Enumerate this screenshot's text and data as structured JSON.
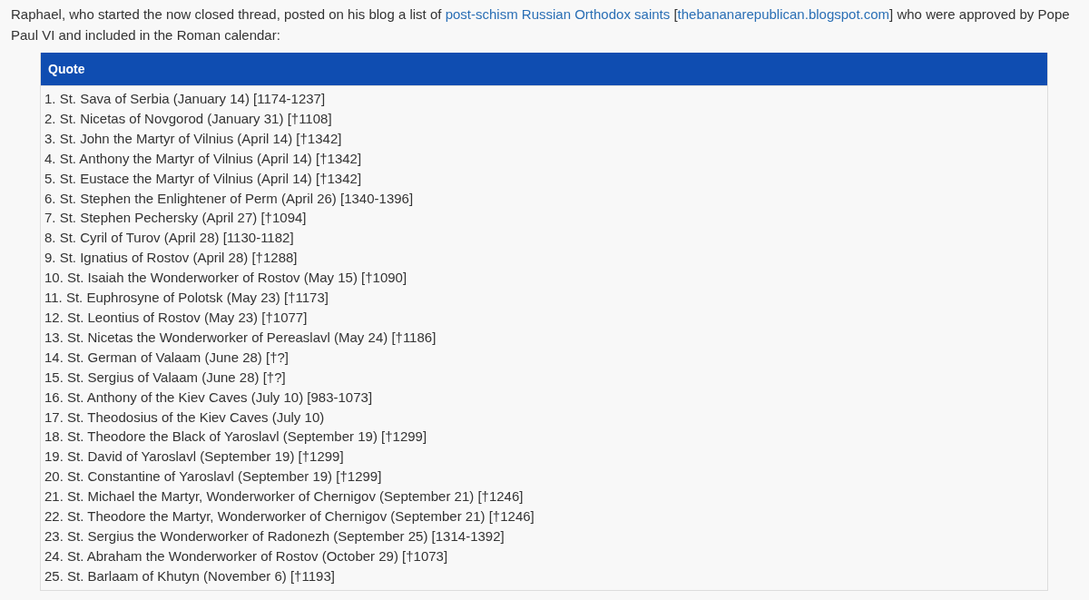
{
  "intro": [
    {
      "kind": "text",
      "text": "Raphael, who started the now closed thread, posted on his blog a list of "
    },
    {
      "kind": "link",
      "text": "post-schism Russian Orthodox saints"
    },
    {
      "kind": "text",
      "text": " ["
    },
    {
      "kind": "link",
      "text": "thebananarepublican.blogspot.com"
    },
    {
      "kind": "text",
      "text": "] who were approved by Pope Paul VI and included in the Roman calendar:"
    }
  ],
  "quote": {
    "title": "Quote",
    "lines": [
      "1. St. Sava of Serbia (January 14) [1174-1237]",
      "2. St. Nicetas of Novgorod (January 31) [†1108]",
      "3. St. John the Martyr of Vilnius (April 14) [†1342]",
      "4. St. Anthony the Martyr of Vilnius (April 14) [†1342]",
      "5. St. Eustace the Martyr of Vilnius (April 14) [†1342]",
      "6. St. Stephen the Enlightener of Perm (April 26) [1340-1396]",
      "7. St. Stephen Pechersky (April 27) [†1094]",
      "8. St. Cyril of Turov (April 28) [1130-1182]",
      "9. St. Ignatius of Rostov (April 28) [†1288]",
      "10. St. Isaiah the Wonderworker of Rostov (May 15) [†1090]",
      "11. St. Euphrosyne of Polotsk (May 23) [†1173]",
      "12. St. Leontius of Rostov (May 23) [†1077]",
      "13. St. Nicetas the Wonderworker of Pereaslavl (May 24) [†1186]",
      "14. St. German of Valaam (June 28) [†?]",
      "15. St. Sergius of Valaam (June 28) [†?]",
      "16. St. Anthony of the Kiev Caves (July 10) [983-1073]",
      "17. St. Theodosius of the Kiev Caves (July 10)",
      "18. St. Theodore the Black of Yaroslavl (September 19) [†1299]",
      "19. St. David of Yaroslavl (September 19) [†1299]",
      "20. St. Constantine of Yaroslavl (September 19) [†1299]",
      "21. St. Michael the Martyr, Wonderworker of Chernigov (September 21) [†1246]",
      "22. St. Theodore the Martyr, Wonderworker of Chernigov (September 21) [†1246]",
      "23. St. Sergius the Wonderworker of Radonezh (September 25) [1314-1392]",
      "24. St. Abraham the Wonderworker of Rostov (October 29) [†1073]",
      "25. St. Barlaam of Khutyn (November 6) [†1193]"
    ]
  }
}
